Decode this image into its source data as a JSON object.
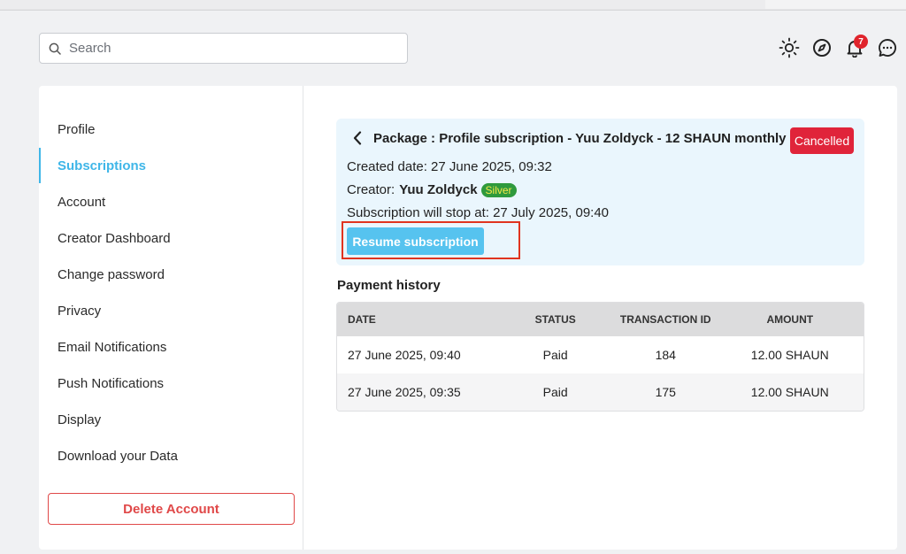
{
  "search": {
    "placeholder": "Search"
  },
  "header": {
    "icons": [
      "sun-icon",
      "compass-icon",
      "bell-icon",
      "chat-icon"
    ],
    "notification_count": "7"
  },
  "sidebar": {
    "items": [
      {
        "label": "Profile",
        "active": false
      },
      {
        "label": "Subscriptions",
        "active": true
      },
      {
        "label": "Account",
        "active": false
      },
      {
        "label": "Creator Dashboard",
        "active": false
      },
      {
        "label": "Change password",
        "active": false
      },
      {
        "label": "Privacy",
        "active": false
      },
      {
        "label": "Email Notifications",
        "active": false
      },
      {
        "label": "Push Notifications",
        "active": false
      },
      {
        "label": "Display",
        "active": false
      },
      {
        "label": "Download your Data",
        "active": false
      }
    ],
    "delete_label": "Delete Account"
  },
  "subscription": {
    "title": "Package : Profile subscription - Yuu Zoldyck - 12 SHAUN monthly",
    "status": "Cancelled",
    "created": "Created date: 27 June 2025, 09:32",
    "creator_prefix": "Creator:",
    "creator_name": "Yuu Zoldyck",
    "creator_tier": "Silver",
    "stop": "Subscription will stop at: 27 July 2025, 09:40",
    "resume_label": "Resume subscription"
  },
  "payment_history": {
    "title": "Payment history",
    "columns": [
      "DATE",
      "STATUS",
      "TRANSACTION ID",
      "AMOUNT"
    ],
    "rows": [
      [
        "27 June 2025, 09:40",
        "Paid",
        "184",
        "12.00 SHAUN"
      ],
      [
        "27 June 2025, 09:35",
        "Paid",
        "175",
        "12.00 SHAUN"
      ]
    ]
  },
  "colors": {
    "accent": "#3fb6e8",
    "danger": "#e0243a",
    "panel_bg": "#eaf6fd",
    "highlight": "#e0341f"
  }
}
